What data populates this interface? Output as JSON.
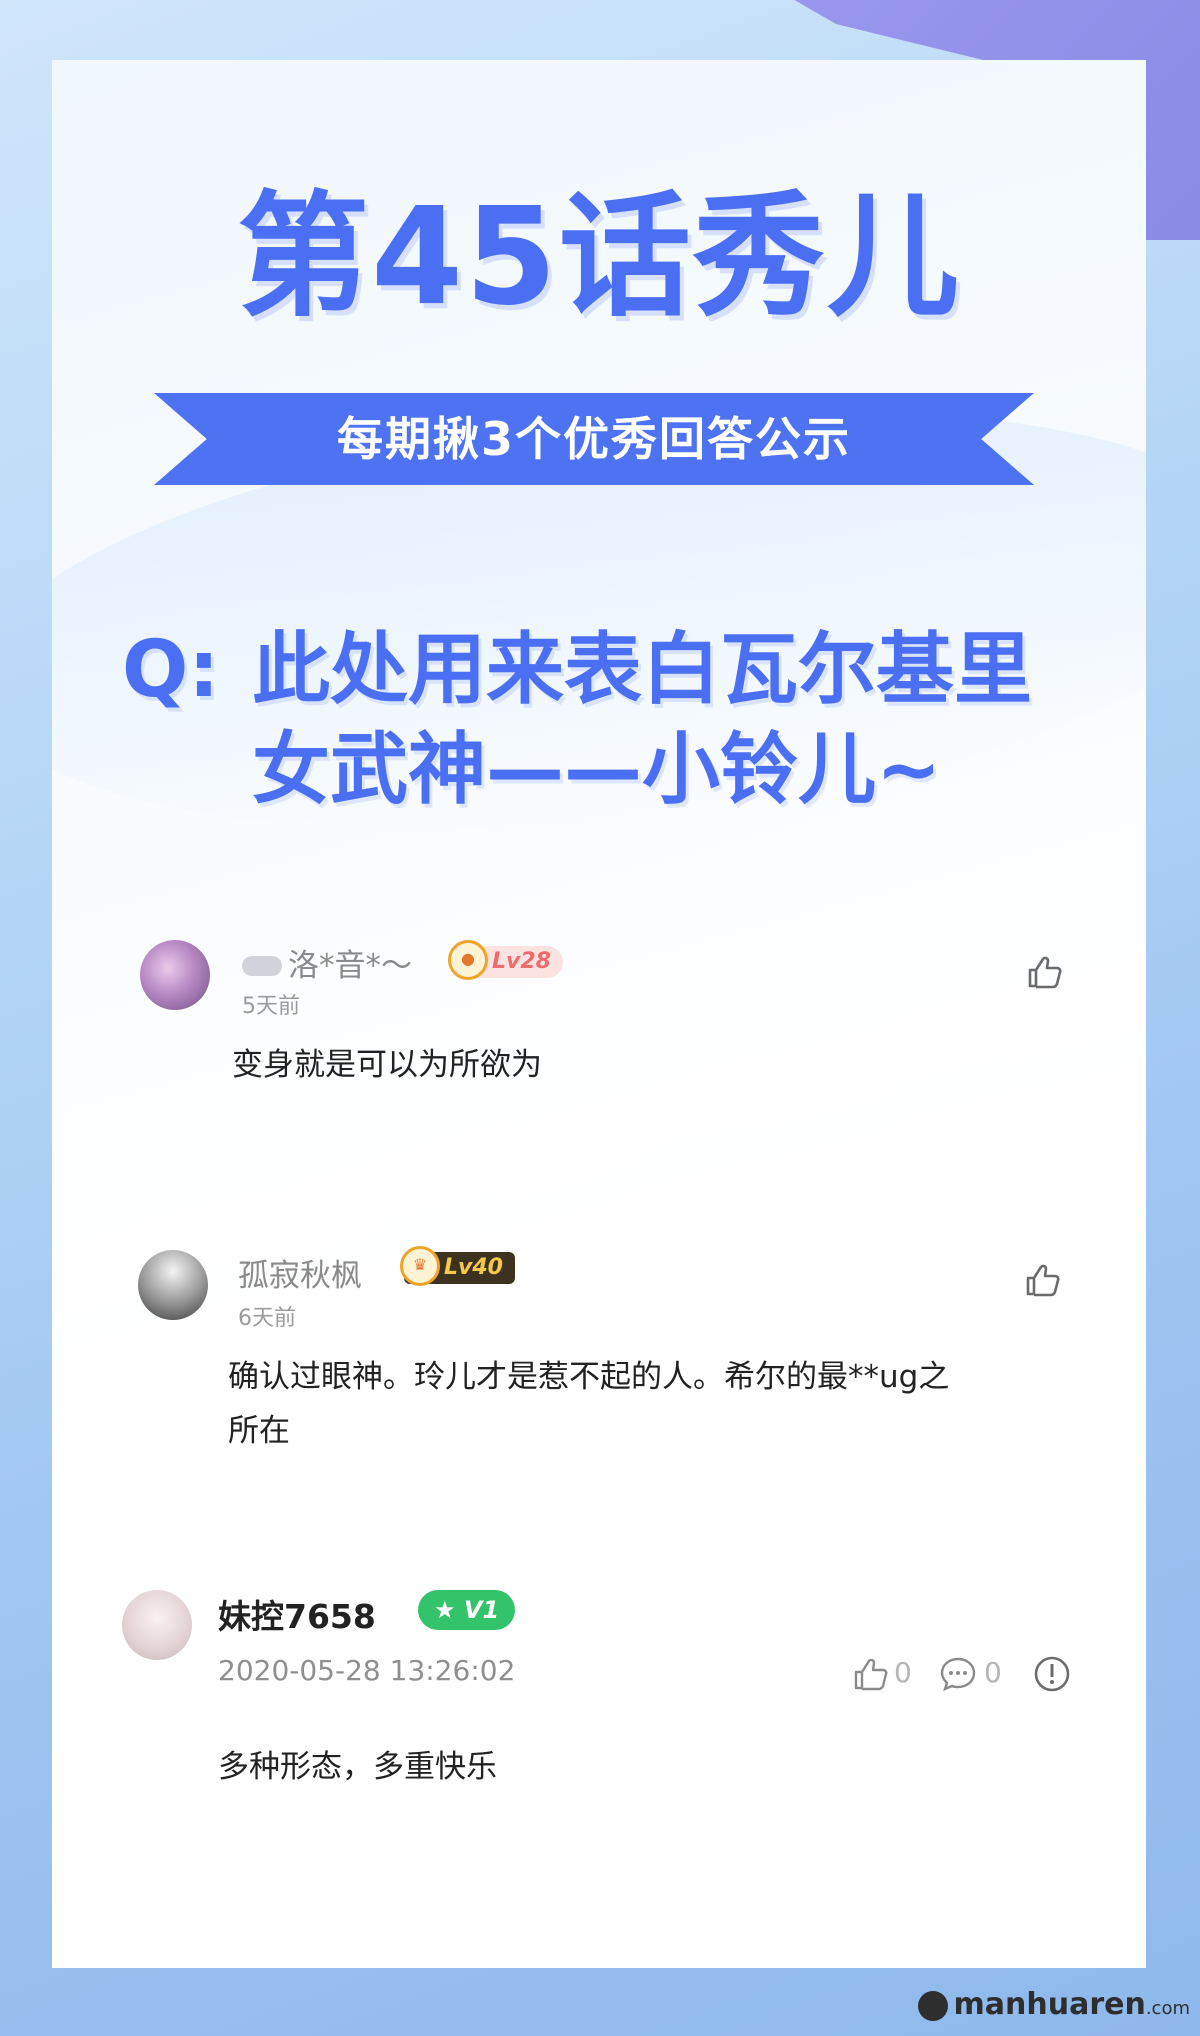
{
  "title": "第45话秀儿",
  "ribbon": "每期揪3个优秀回答公示",
  "question": {
    "prefix": "Q:",
    "text": "此处用来表白瓦尔基里\n女武神——小铃儿~"
  },
  "comments": [
    {
      "username": "洛*音*～",
      "level": "Lv28",
      "time": "5天前",
      "content": "变身就是可以为所欲为"
    },
    {
      "username": "孤寂秋枫",
      "level": "Lv40",
      "time": "6天前",
      "content_line1": "确认过眼神。玲儿才是惹不起的人。希尔的最**ug之",
      "content_line2": "所在"
    },
    {
      "username": "妹控7658",
      "badge": "V1",
      "time": "2020-05-28 13:26:02",
      "likes": "0",
      "replies": "0",
      "content": "多种形态，多重快乐"
    }
  ],
  "watermark": {
    "site": "manhuaren",
    "domain": ".com"
  },
  "colors": {
    "accent": "#4b6ff2",
    "ribbon": "#4d72f2",
    "badge_green": "#33c36a"
  }
}
